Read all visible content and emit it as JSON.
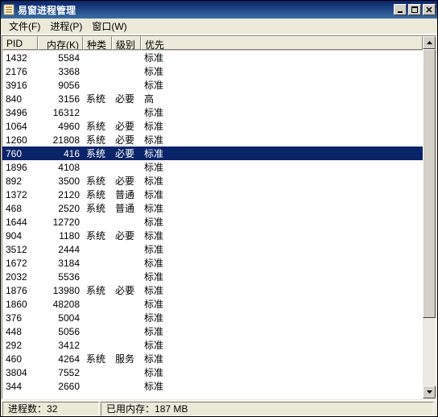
{
  "window": {
    "title": "易窗进程管理"
  },
  "menu": {
    "file": "文件(F)",
    "process": "进程(P)",
    "window": "窗口(W)"
  },
  "columns": {
    "pid": "PID",
    "memory": "内存(K)",
    "kind": "种类",
    "level": "级别",
    "priority": "优先"
  },
  "rows": [
    {
      "pid": "1432",
      "mem": "5584",
      "kind": "",
      "level": "",
      "prio": "标准",
      "sel": false
    },
    {
      "pid": "2176",
      "mem": "3368",
      "kind": "",
      "level": "",
      "prio": "标准",
      "sel": false
    },
    {
      "pid": "3916",
      "mem": "9056",
      "kind": "",
      "level": "",
      "prio": "标准",
      "sel": false
    },
    {
      "pid": "840",
      "mem": "3156",
      "kind": "系统",
      "level": "必要",
      "prio": "高",
      "sel": false
    },
    {
      "pid": "3496",
      "mem": "16312",
      "kind": "",
      "level": "",
      "prio": "标准",
      "sel": false
    },
    {
      "pid": "1064",
      "mem": "4960",
      "kind": "系统",
      "level": "必要",
      "prio": "标准",
      "sel": false
    },
    {
      "pid": "1260",
      "mem": "21808",
      "kind": "系统",
      "level": "必要",
      "prio": "标准",
      "sel": false
    },
    {
      "pid": "760",
      "mem": "416",
      "kind": "系统",
      "level": "必要",
      "prio": "标准",
      "sel": true
    },
    {
      "pid": "1896",
      "mem": "4108",
      "kind": "",
      "level": "",
      "prio": "标准",
      "sel": false
    },
    {
      "pid": "892",
      "mem": "3500",
      "kind": "系统",
      "level": "必要",
      "prio": "标准",
      "sel": false
    },
    {
      "pid": "1372",
      "mem": "2120",
      "kind": "系统",
      "level": "普通",
      "prio": "标准",
      "sel": false
    },
    {
      "pid": "468",
      "mem": "2520",
      "kind": "系统",
      "level": "普通",
      "prio": "标准",
      "sel": false
    },
    {
      "pid": "1644",
      "mem": "12720",
      "kind": "",
      "level": "",
      "prio": "标准",
      "sel": false
    },
    {
      "pid": "904",
      "mem": "1180",
      "kind": "系统",
      "level": "必要",
      "prio": "标准",
      "sel": false
    },
    {
      "pid": "3512",
      "mem": "2444",
      "kind": "",
      "level": "",
      "prio": "标准",
      "sel": false
    },
    {
      "pid": "1672",
      "mem": "3184",
      "kind": "",
      "level": "",
      "prio": "标准",
      "sel": false
    },
    {
      "pid": "2032",
      "mem": "5536",
      "kind": "",
      "level": "",
      "prio": "标准",
      "sel": false
    },
    {
      "pid": "1876",
      "mem": "13980",
      "kind": "系统",
      "level": "必要",
      "prio": "标准",
      "sel": false
    },
    {
      "pid": "1860",
      "mem": "48208",
      "kind": "",
      "level": "",
      "prio": "标准",
      "sel": false
    },
    {
      "pid": "376",
      "mem": "5004",
      "kind": "",
      "level": "",
      "prio": "标准",
      "sel": false
    },
    {
      "pid": "448",
      "mem": "5056",
      "kind": "",
      "level": "",
      "prio": "标准",
      "sel": false
    },
    {
      "pid": "292",
      "mem": "3412",
      "kind": "",
      "level": "",
      "prio": "标准",
      "sel": false
    },
    {
      "pid": "460",
      "mem": "4264",
      "kind": "系统",
      "level": "服务",
      "prio": "标准",
      "sel": false
    },
    {
      "pid": "3804",
      "mem": "7552",
      "kind": "",
      "level": "",
      "prio": "标准",
      "sel": false
    },
    {
      "pid": "344",
      "mem": "2660",
      "kind": "",
      "level": "",
      "prio": "标准",
      "sel": false
    }
  ],
  "status": {
    "proc_label": "进程数：",
    "proc_value": "32",
    "mem_label": "已用内存：",
    "mem_value": "187 MB"
  }
}
